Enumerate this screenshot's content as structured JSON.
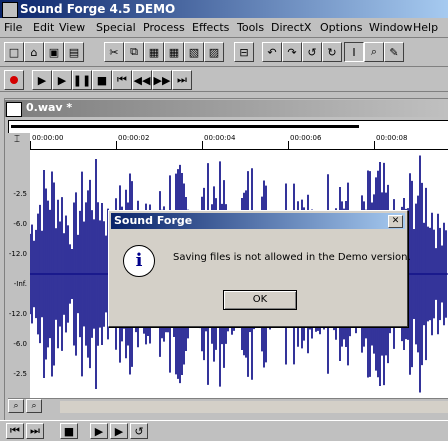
{
  "app": {
    "title": "Sound Forge 4.5 DEMO"
  },
  "menu": [
    "File",
    "Edit",
    "View",
    "Special",
    "Process",
    "Effects",
    "Tools",
    "DirectX",
    "Options",
    "Window",
    "Help"
  ],
  "document": {
    "title": "0.wav *"
  },
  "ruler": {
    "labels": [
      "00:00:00",
      "00:00:02",
      "00:00:04",
      "00:00:06",
      "00:00:08"
    ]
  },
  "scale": {
    "labels": [
      "-2.5",
      "-6.0",
      "-12.0",
      "-Inf.",
      "-12.0",
      "-6.0",
      "-2.5"
    ]
  },
  "dialog": {
    "title": "Sound Forge",
    "message": "Saving files is not allowed in the Demo version.",
    "ok_label": "OK",
    "close_glyph": "✕",
    "icon_glyph": "i"
  },
  "colors": {
    "waveform": "#000080",
    "titlebar": "#0a246a"
  }
}
